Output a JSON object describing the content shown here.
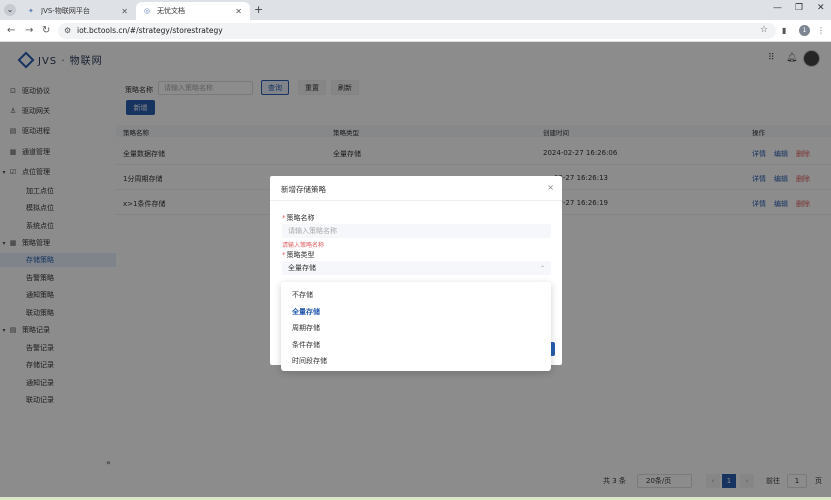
{
  "browser": {
    "tabs": [
      {
        "title": "JVS-物联网平台",
        "active": false
      },
      {
        "title": "无忧文档",
        "active": true
      }
    ],
    "url": "iot.bctools.cn/#/strategy/storestrategy",
    "profile_initial": "1"
  },
  "app": {
    "logo_text": "JVS · 物联网",
    "colors": {
      "primary": "#2a5db0",
      "danger": "#e06060",
      "active_bg": "#e8f0fb"
    }
  },
  "sidebar": {
    "items": [
      {
        "label": "驱动协议",
        "icon": "protocol-icon"
      },
      {
        "label": "驱动网关",
        "icon": "gateway-icon"
      },
      {
        "label": "驱动进程",
        "icon": "process-icon"
      },
      {
        "label": "通道管理",
        "icon": "channel-icon"
      },
      {
        "label": "点位管理",
        "icon": "points-icon",
        "group": true
      },
      {
        "label": "加工点位"
      },
      {
        "label": "模拟点位"
      },
      {
        "label": "系统点位"
      },
      {
        "label": "策略管理",
        "icon": "strategy-icon",
        "group": true
      },
      {
        "label": "存储策略",
        "active": true
      },
      {
        "label": "告警策略"
      },
      {
        "label": "通知策略"
      },
      {
        "label": "联动策略"
      },
      {
        "label": "策略记录",
        "icon": "record-icon",
        "group": true
      },
      {
        "label": "告警记录"
      },
      {
        "label": "存储记录"
      },
      {
        "label": "通知记录"
      },
      {
        "label": "联动记录"
      }
    ],
    "collapse": "«"
  },
  "filter": {
    "label": "策略名称",
    "placeholder": "请输入策略名称",
    "query": "查询",
    "reset": "重置",
    "refresh": "刷新",
    "add": "新增"
  },
  "table": {
    "headers": [
      "策略名称",
      "策略类型",
      "创建时间",
      "操作"
    ],
    "rows": [
      {
        "name": "全量数据存储",
        "type": "全量存储",
        "time": "2024-02-27 16:26:06"
      },
      {
        "name": "1分周期存储",
        "type": "",
        "time": "02-27 16:26:13"
      },
      {
        "name": "x>1条件存储",
        "type": "",
        "time": "02-27 16:26:19"
      }
    ],
    "actions": {
      "detail": "详情",
      "edit": "编辑",
      "delete": "删除"
    }
  },
  "pagination": {
    "total": "共 3 条",
    "page_size": "20条/页",
    "current": "1",
    "goto_label": "前往",
    "goto_value": "1",
    "page_unit": "页"
  },
  "dialog": {
    "title": "新增存储策略",
    "close": "×",
    "name_label": "策略名称",
    "name_placeholder": "请输入策略名称",
    "name_error": "请输入策略名称",
    "type_label": "策略类型",
    "type_value": "全量存储",
    "required_mark": "*",
    "caret": "⌃"
  },
  "dropdown": {
    "options": [
      {
        "label": "不存储"
      },
      {
        "label": "全量存储",
        "selected": true
      },
      {
        "label": "周期存储"
      },
      {
        "label": "条件存储"
      },
      {
        "label": "时间段存储"
      }
    ]
  }
}
